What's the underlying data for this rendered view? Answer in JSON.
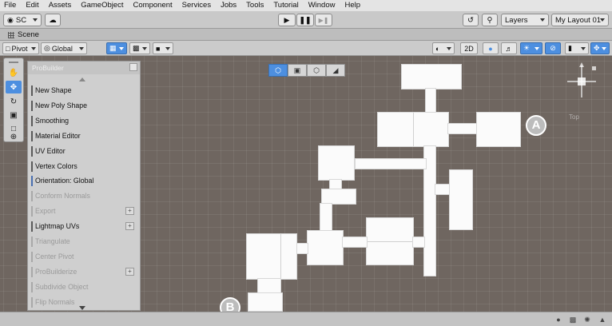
{
  "menu": [
    "File",
    "Edit",
    "Assets",
    "GameObject",
    "Component",
    "Services",
    "Jobs",
    "Tools",
    "Tutorial",
    "Window",
    "Help"
  ],
  "toolbar": {
    "account": "SC",
    "layers": "Layers",
    "layout": "My Layout 01"
  },
  "scene_tab": {
    "label": "Scene"
  },
  "scene_toolbar": {
    "pivot": "Pivot",
    "global": "Global",
    "mode_2d": "2D"
  },
  "probuilder": {
    "title": "ProBuilder",
    "items": [
      {
        "label": "New Shape",
        "enabled": true,
        "bar": "#5a5a5a"
      },
      {
        "label": "New Poly Shape",
        "enabled": true,
        "bar": "#5a5a5a"
      },
      {
        "label": "Smoothing",
        "enabled": true,
        "bar": "#5a5a5a"
      },
      {
        "label": "Material Editor",
        "enabled": true,
        "bar": "#5a5a5a"
      },
      {
        "label": "UV Editor",
        "enabled": true,
        "bar": "#5a5a5a"
      },
      {
        "label": "Vertex Colors",
        "enabled": true,
        "bar": "#5a5a5a"
      },
      {
        "label": "Orientation: Global",
        "enabled": true,
        "bar": "#4a6fb0"
      },
      {
        "label": "Conform Normals",
        "enabled": false
      },
      {
        "label": "Export",
        "enabled": false,
        "has_options": true
      },
      {
        "label": "Lightmap UVs",
        "enabled": true,
        "bar": "#5a5a5a",
        "has_options": true
      },
      {
        "label": "Triangulate",
        "enabled": false
      },
      {
        "label": "Center Pivot",
        "enabled": false
      },
      {
        "label": "ProBuilderize",
        "enabled": false,
        "has_options": true
      },
      {
        "label": "Subdivide Object",
        "enabled": false
      },
      {
        "label": "Flip Normals",
        "enabled": false
      }
    ]
  },
  "gizmo": {
    "label": "Top"
  },
  "callouts": {
    "a": "A",
    "b": "B"
  },
  "colors": {
    "accent": "#4d8fe0",
    "viewport": "#6f6660",
    "geometry": "#fbfbfb"
  }
}
